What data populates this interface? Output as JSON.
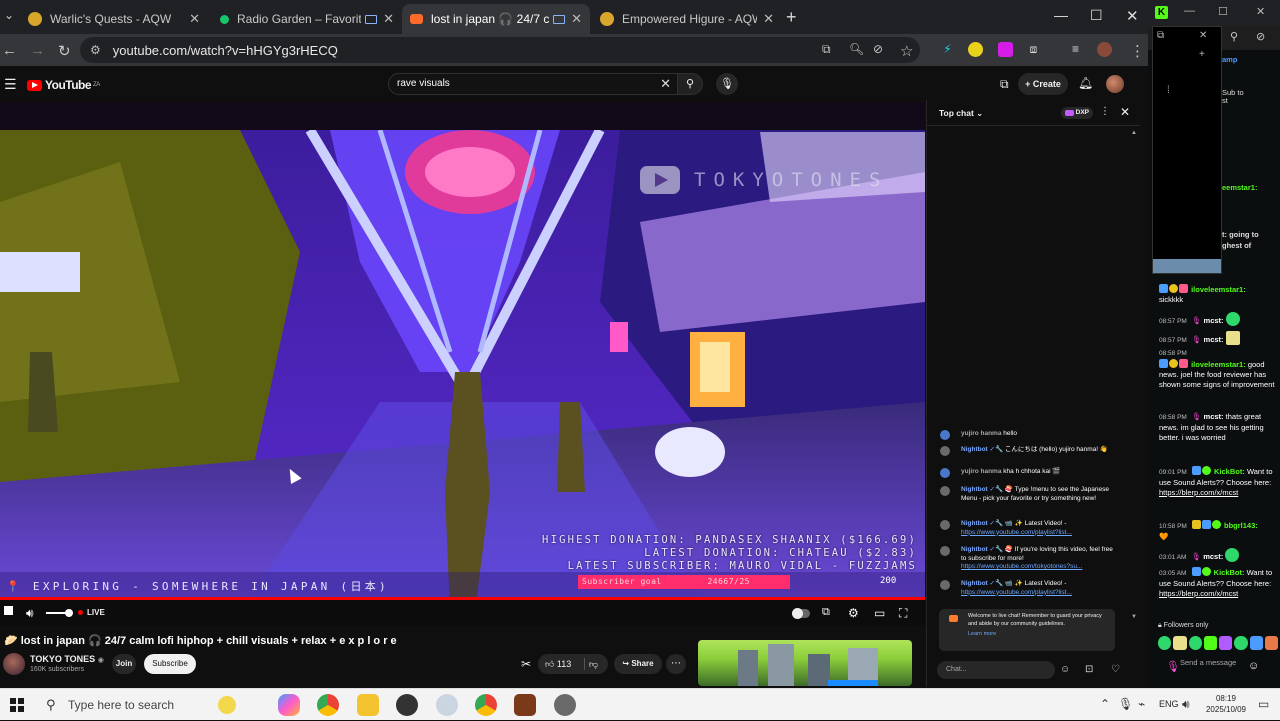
{
  "browser": {
    "tabs": [
      {
        "title": "Warlic's Quests - AQW",
        "active": false
      },
      {
        "title": "Radio Garden – Favorites",
        "active": false
      },
      {
        "title": "lost in japan 🎧 24/7 c",
        "active": true
      },
      {
        "title": "Empowered Higure - AQW",
        "active": false
      }
    ],
    "url": "youtube.com/watch?v=hHGYg3rHECQ"
  },
  "youtube": {
    "logo": "YouTube",
    "logo_region": "ZA",
    "search_value": "rave visuals",
    "create_label": "Create"
  },
  "video": {
    "watermark": "TOKYOTONES",
    "overlay_highest_donation": "HIGHEST DONATION: PANDASEX SHAANIX ($166.69)",
    "overlay_latest_donation": "LATEST DONATION: CHATEAU ($2.83)",
    "overlay_latest_subscriber": "LATEST SUBSCRIBER: MAURO VIDAL - FUZZJAMS",
    "overlay_exploring": "📍 EXPLORING - SOMEWHERE IN JAPAN (日本)",
    "subscriber_goal_label": "Subscriber goal",
    "subscriber_goal_value": "24667/25",
    "subscriber_goal_number": "200",
    "live_label": "LIVE",
    "title": "🥟 lost in japan 🎧 24/7 calm lofi hiphop + chill visuals + relax + e x p l o r e",
    "channel": "TOKYO TONES",
    "channel_subs": "160K subscribers",
    "join_label": "Join",
    "subscribe_label": "Subscribe",
    "likes": "113",
    "share_label": "Share"
  },
  "live_chat": {
    "header": "Top chat",
    "dxp_label": "DXP",
    "messages": [
      {
        "author": "yujiro hanma",
        "text": "hello"
      },
      {
        "author": "Nightbot ✓🔧",
        "text": "こんにちは (hello) yujiro hanma! 👋"
      },
      {
        "author": "yujiro hanma",
        "text": "kha h chhota kai 🎬"
      },
      {
        "author": "Nightbot ✓🔧",
        "text": "🍣 Type !menu to see the Japanese Menu - pick your favorite or try something new!"
      },
      {
        "author": "Nightbot ✓🔧",
        "text": "📹 ✨ Latest Video! - ",
        "link": "https://www.youtube.com/playlist?list..."
      },
      {
        "author": "Nightbot ✓🔧",
        "text": "🍣 If you're loving this video, feel free to subscribe for more! ",
        "link": "https://www.youtube.com/tokyotones?su..."
      },
      {
        "author": "Nightbot ✓🔧",
        "text": "📹 ✨ Latest Video! - ",
        "link": "https://www.youtube.com/playlist?list..."
      }
    ],
    "welcome_text": "Welcome to live chat! Remember to guard your privacy and abide by our community guidelines.",
    "learn_more": "Learn more",
    "input_placeholder": "Chat..."
  },
  "kick": {
    "side_text_1": "amp",
    "side_text_2": "Sub to",
    "side_text_3": "st",
    "side_text_4": "eemstar1:",
    "side_text_5": "t: going to",
    "side_text_6": "ghest of",
    "messages": [
      {
        "time": "08:57 PM",
        "user": "iloveleemstar1:",
        "text": "sickkkk",
        "color": "#53fc18"
      },
      {
        "time": "08:57 PM",
        "user": "mcst:",
        "text": "",
        "color": "#ff4bd8"
      },
      {
        "time": "08:57 PM",
        "user": "mcst:",
        "text": "",
        "color": "#ff4bd8"
      },
      {
        "time": "08:58 PM",
        "user": "iloveleemstar1:",
        "text": "good news. joel the food reviewer has shown some signs of improvement",
        "color": "#53fc18"
      },
      {
        "time": "08:58 PM",
        "user": "mcst:",
        "text": "thats great news. im glad to see his getting better. i was worried",
        "color": "#ff4bd8"
      },
      {
        "time": "09:01 PM",
        "user": "KickBot:",
        "text": "Want to use Sound Alerts?? Choose here: ",
        "link": "https://blerp.com/x/mcst",
        "color": "#53fc18"
      },
      {
        "time": "10:58 PM",
        "user": "bbgrl143:",
        "text": "🧡",
        "color": "#53fc18"
      },
      {
        "time": "03:01 AM",
        "user": "mcst:",
        "text": "",
        "color": "#ff4bd8"
      },
      {
        "time": "03:05 AM",
        "user": "KickBot:",
        "text": "Want to use Sound Alerts?? Choose here: ",
        "link": "https://blerp.com/x/mcst",
        "color": "#53fc18"
      }
    ],
    "followers_only": "Followers only",
    "send_placeholder": "Send a message"
  },
  "taskbar": {
    "search_placeholder": "Type here to search",
    "language": "ENG",
    "time": "08:19",
    "date": "2025/10/09"
  },
  "colors": {
    "youtube_red": "#ff0000",
    "kick_green": "#53fc18",
    "subscriber_goal": "#ff2d6b"
  }
}
